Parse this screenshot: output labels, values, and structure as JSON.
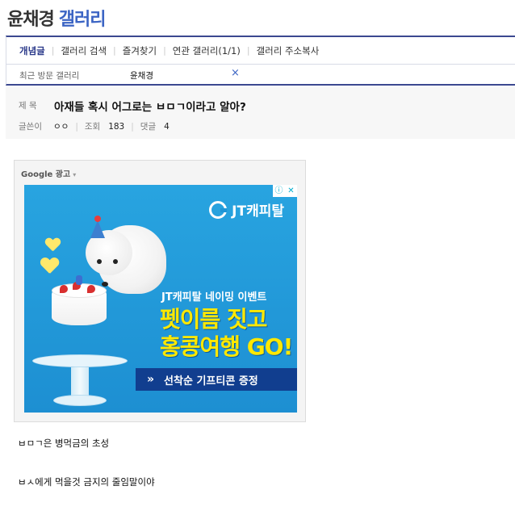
{
  "gallery": {
    "name": "윤채경",
    "suffix": "갤러리"
  },
  "menu": {
    "items": [
      {
        "label": "개념글",
        "active": true
      },
      {
        "label": "갤러리 검색",
        "active": false
      },
      {
        "label": "즐겨찾기",
        "active": false
      },
      {
        "label": "연관 갤러리(1/1)",
        "active": false
      },
      {
        "label": "갤러리 주소복사",
        "active": false
      }
    ]
  },
  "recent": {
    "label": "최근 방문 갤러리",
    "item": "윤채경",
    "close": "×"
  },
  "post": {
    "subject_label": "제 목",
    "subject": "아재들 혹시 어그로는 ㅂㅁㄱ이라고 알아?",
    "author_label": "글쓴이",
    "author": "ㅇㅇ",
    "views_label": "조회",
    "views": "183",
    "comments_label": "댓글",
    "comments": "4",
    "body": [
      "ㅂㅁㄱ은 병먹금의 초성",
      "ㅂㅅ에게 먹을것 금지의 줄임말이야"
    ]
  },
  "ad": {
    "label": "Google 광고",
    "caret": "▾",
    "info": "ⓘ",
    "close": "✕",
    "brand": "JT캐피탈",
    "event": "JT캐피탈 네이밍 이벤트",
    "headline_1": "펫이름 짓고",
    "headline_2": "홍콩여행 GO!",
    "cta": "선착순 기프티콘 증정",
    "cta_icon": "»",
    "colors": {
      "background": "#1d8fd2",
      "headline": "#ffe800",
      "cta": "#113e8f"
    }
  },
  "colors": {
    "accent": "#3b64c4",
    "nav_border": "#3b4890"
  }
}
